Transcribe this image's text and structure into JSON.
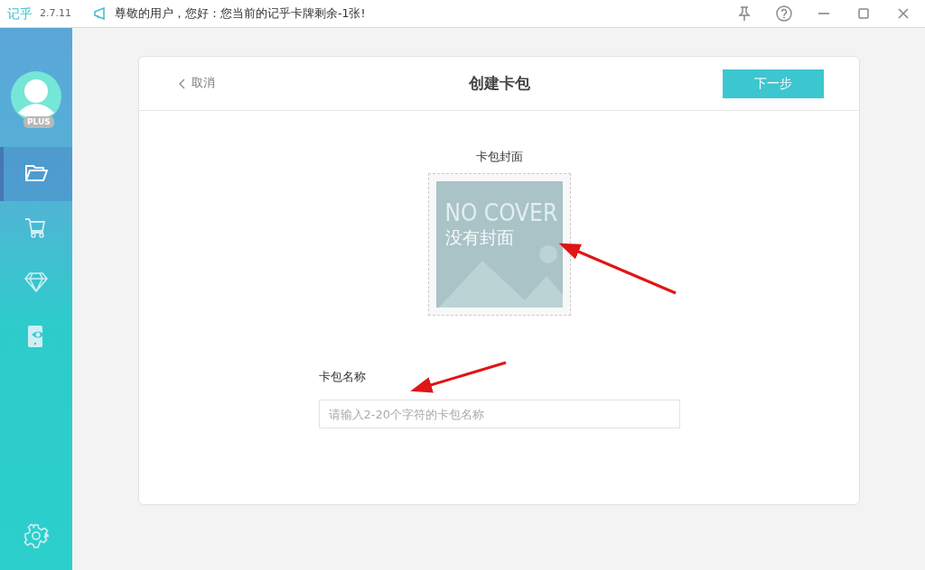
{
  "titlebar": {
    "app_name": "记乎",
    "version": "2.7.11",
    "notice": "尊敬的用户，您好：您当前的记乎卡牌剩余-1张!"
  },
  "sidebar": {
    "badge": "PLUS",
    "items": [
      {
        "kind": "folder",
        "selected": true
      },
      {
        "kind": "cart",
        "selected": false
      },
      {
        "kind": "diamond",
        "selected": false
      },
      {
        "kind": "phone-eye",
        "selected": false
      }
    ]
  },
  "dialog": {
    "cancel": "取消",
    "title": "创建卡包",
    "next": "下一步",
    "cover_label": "卡包封面",
    "cover": {
      "title": "NO COVER",
      "subtitle": "没有封面"
    },
    "name_label": "卡包名称",
    "name_field": {
      "placeholder": "请输入2-20个字符的卡包名称"
    }
  }
}
